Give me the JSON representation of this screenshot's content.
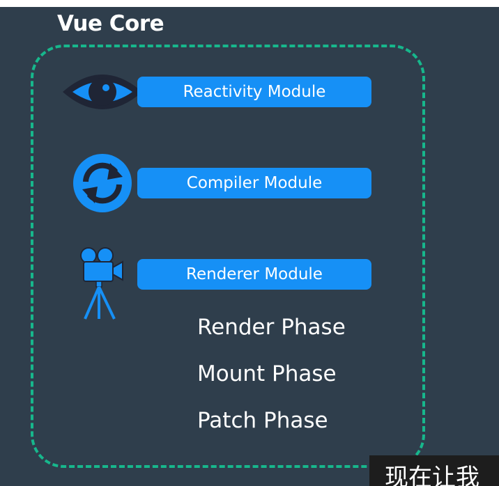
{
  "title": "Vue Core",
  "modules": [
    {
      "label": "Reactivity Module",
      "icon": "eye-icon"
    },
    {
      "label": "Compiler Module",
      "icon": "refresh-icon"
    },
    {
      "label": "Renderer Module",
      "icon": "movie-camera-icon"
    }
  ],
  "phases": [
    "Render Phase",
    "Mount Phase",
    "Patch Phase"
  ],
  "subtitle": "现在让我",
  "colors": {
    "background": "#2f3e4c",
    "frame": "#17b78c",
    "module": "#1690f6",
    "icon_dark": "#1f2535"
  }
}
